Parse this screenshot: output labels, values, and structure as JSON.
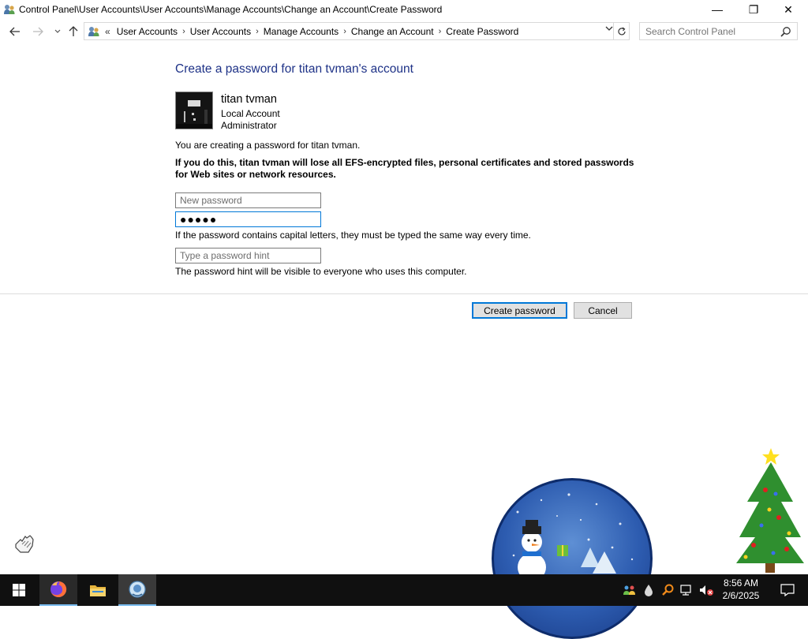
{
  "window": {
    "title": "Control Panel\\User Accounts\\User Accounts\\Manage Accounts\\Change an Account\\Create Password",
    "minimize_glyph": "—",
    "maximize_glyph": "❐",
    "close_glyph": "✕"
  },
  "nav": {
    "lead": "«",
    "breadcrumbs": [
      "User Accounts",
      "User Accounts",
      "Manage Accounts",
      "Change an Account",
      "Create Password"
    ],
    "search_placeholder": "Search Control Panel"
  },
  "content": {
    "title": "Create a password for titan tvman's account",
    "account_name": "titan tvman",
    "account_type": "Local Account",
    "account_role": "Administrator",
    "info": "You are creating a password for titan tvman.",
    "warning": "If you do this, titan tvman will lose all EFS-encrypted files, personal certificates and stored passwords for Web sites or network resources.",
    "new_password_placeholder": "New password",
    "confirm_password_value": "●●●●●",
    "case_note": "If the password contains capital letters, they must be typed the same way every time.",
    "hint_placeholder": "Type a password hint",
    "hint_note": "The password hint will be visible to everyone who uses this computer.",
    "create_button": "Create password",
    "cancel_button": "Cancel"
  },
  "taskbar": {
    "pinned": [
      "start-icon",
      "firefox-icon",
      "file-explorer-icon",
      "control-panel-icon"
    ],
    "tray_icons": [
      "people-icon",
      "dropbox-icon",
      "search-tool-icon",
      "network-icon",
      "volume-muted-icon"
    ],
    "time": "8:56 AM",
    "date": "2/6/2025"
  },
  "colors": {
    "title_blue": "#1e3287",
    "focus_blue": "#0078d7",
    "taskbar": "#101010"
  }
}
